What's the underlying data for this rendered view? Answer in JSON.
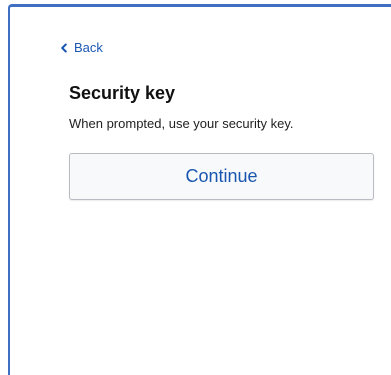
{
  "nav": {
    "back_label": "Back"
  },
  "content": {
    "title": "Security key",
    "description": "When prompted, use your security key.",
    "continue_label": "Continue"
  },
  "colors": {
    "accent": "#1a56b0",
    "frame_border": "#3f6ec2"
  },
  "icons": {
    "back": "chevron-left-icon"
  }
}
